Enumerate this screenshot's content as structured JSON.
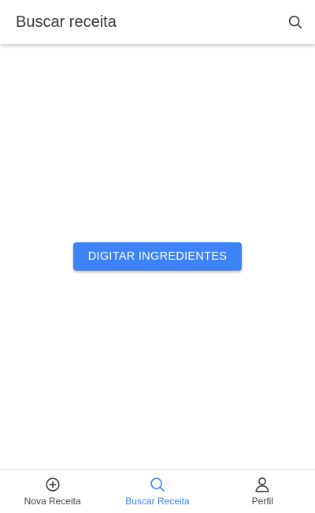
{
  "header": {
    "title": "Buscar receita",
    "search_icon": "search-icon"
  },
  "main": {
    "button_label": "DIGITAR INGREDIENTES"
  },
  "bottom_nav": {
    "items": [
      {
        "label": "Nova Receita",
        "icon": "plus-circle-icon",
        "active": false
      },
      {
        "label": "Buscar Receita",
        "icon": "search-icon",
        "active": true
      },
      {
        "label": "Perfil",
        "icon": "user-icon",
        "active": false
      }
    ]
  },
  "colors": {
    "accent": "#3e82f7",
    "text": "#3a3a3a",
    "nav_text": "#444444"
  }
}
